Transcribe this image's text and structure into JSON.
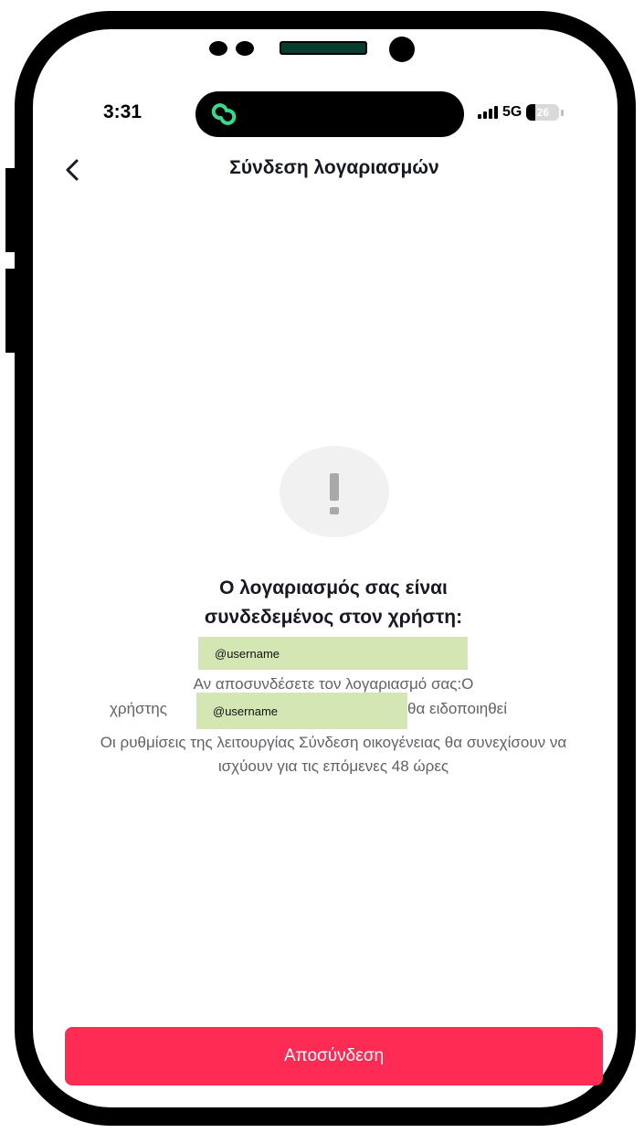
{
  "status_bar": {
    "time": "3:31",
    "network": "5G",
    "battery": "26",
    "battery_level_percent": 26,
    "island_icon": "link-app-icon",
    "accent_color": "#39d98a"
  },
  "header": {
    "back_icon": "chevron-left-icon",
    "title": "Σύνδεση λογαριασμών"
  },
  "alert": {
    "icon": "exclamation-icon",
    "heading_line1": "Ο λογαριασμός σας είναι",
    "heading_line2": "συνδεδεμένος στον χρήστη:",
    "username_1": "@username",
    "info_line1": "Αν αποσυνδέσετε τον λογαριασμό σας:Ο",
    "info_line2_start": "χρήστης",
    "username_2": "@username",
    "info_line2_end": "θα ειδοποιηθεί",
    "note": "Οι ρυθμίσεις της λειτουργίας Σύνδεση οικογένειας θα συνεχίσουν να ισχύουν για τις επόμενες 48 ώρες",
    "highlight_color": "#d4e6b4"
  },
  "actions": {
    "unlink_label": "Αποσύνδεση",
    "unlink_color": "#fe2c55"
  }
}
